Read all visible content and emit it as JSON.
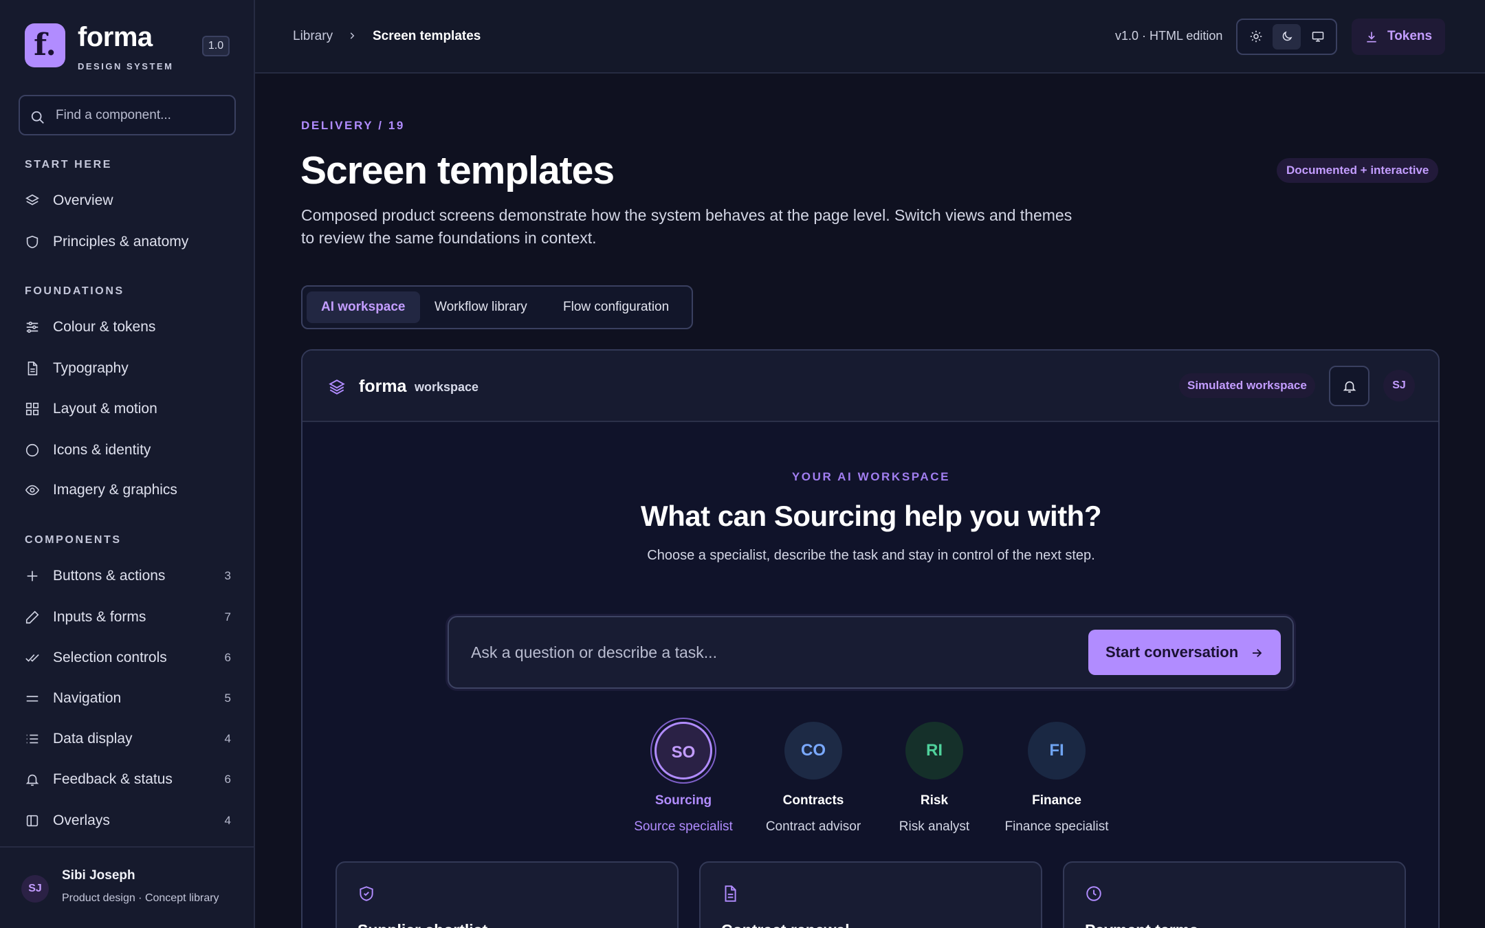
{
  "sidebar": {
    "brand": {
      "logo_letter": "f.",
      "name": "forma",
      "subtitle": "DESIGN SYSTEM",
      "version": "1.0"
    },
    "search": {
      "placeholder": "Find a component..."
    },
    "sections": [
      {
        "title": "START HERE",
        "items": [
          {
            "label": "Overview",
            "icon": "layers-icon"
          },
          {
            "label": "Principles & anatomy",
            "icon": "shield-icon"
          }
        ]
      },
      {
        "title": "FOUNDATIONS",
        "items": [
          {
            "label": "Colour & tokens",
            "icon": "sliders-icon"
          },
          {
            "label": "Typography",
            "icon": "document-icon"
          },
          {
            "label": "Layout & motion",
            "icon": "grid-icon"
          },
          {
            "label": "Icons & identity",
            "icon": "circle-icon"
          },
          {
            "label": "Imagery & graphics",
            "icon": "eye-icon"
          }
        ]
      },
      {
        "title": "COMPONENTS",
        "items": [
          {
            "label": "Buttons & actions",
            "icon": "plus-icon",
            "count": "3"
          },
          {
            "label": "Inputs & forms",
            "icon": "pencil-icon",
            "count": "7"
          },
          {
            "label": "Selection controls",
            "icon": "double-check-icon",
            "count": "6"
          },
          {
            "label": "Navigation",
            "icon": "menu-icon",
            "count": "5"
          },
          {
            "label": "Data display",
            "icon": "list-icon",
            "count": "4"
          },
          {
            "label": "Feedback & status",
            "icon": "bell-icon",
            "count": "6"
          },
          {
            "label": "Overlays",
            "icon": "panel-icon",
            "count": "4"
          }
        ]
      }
    ],
    "user": {
      "initials": "SJ",
      "name": "Sibi Joseph",
      "role": "Product design · Concept library"
    }
  },
  "topbar": {
    "breadcrumb": [
      "Library",
      "Screen templates"
    ],
    "version_text": "v1.0 · HTML edition",
    "theme_options": [
      "sun-icon",
      "moon-icon",
      "monitor-icon"
    ],
    "theme_selected": "moon-icon",
    "tokens_label": "Tokens"
  },
  "main": {
    "eyebrow": "DELIVERY / 19",
    "title": "Screen templates",
    "badge": "Documented + interactive",
    "description": "Composed product screens demonstrate how the system behaves at the page level. Switch views and themes to review the same foundations in context.",
    "view_tabs": [
      "AI workspace",
      "Workflow library",
      "Flow configuration"
    ],
    "active_view": "AI workspace"
  },
  "workspace": {
    "brand": "forma",
    "brand_sub": "workspace",
    "badge": "Simulated workspace",
    "avatar": "SJ",
    "eyebrow": "YOUR AI WORKSPACE",
    "title": "What can Sourcing help you with?",
    "subtitle": "Choose a specialist, describe the task and stay in control of the next step.",
    "ask_placeholder": "Ask a question or describe a task...",
    "start_label": "Start conversation",
    "specialists": [
      {
        "initials": "SO",
        "name": "Sourcing",
        "role": "Source specialist",
        "selected": true,
        "bg": "#2a2145",
        "fg": "#c39dff"
      },
      {
        "initials": "CO",
        "name": "Contracts",
        "role": "Contract advisor",
        "selected": false,
        "bg": "#1d2a45",
        "fg": "#7aa9ff"
      },
      {
        "initials": "RI",
        "name": "Risk",
        "role": "Risk analyst",
        "selected": false,
        "bg": "#15302a",
        "fg": "#4fd19b"
      },
      {
        "initials": "FI",
        "name": "Finance",
        "role": "Finance specialist",
        "selected": false,
        "bg": "#1a2843",
        "fg": "#6fa4f2"
      }
    ],
    "task_cards": [
      {
        "title": "Supplier shortlist",
        "icon": "shield-icon"
      },
      {
        "title": "Contract renewal",
        "icon": "document-icon"
      },
      {
        "title": "Payment terms",
        "icon": "clock-icon"
      }
    ]
  },
  "colors": {
    "accent": "#b18cff",
    "background": "#0f1120",
    "sidebar": "#161a2d",
    "border": "#3a4060"
  }
}
